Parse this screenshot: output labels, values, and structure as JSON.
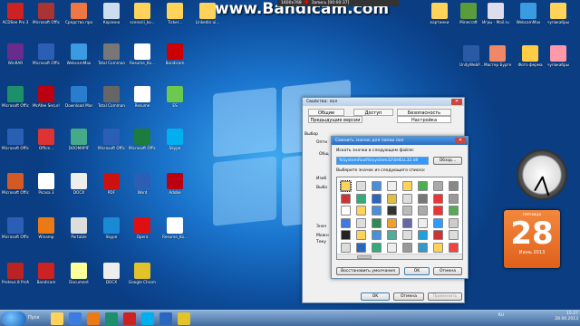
{
  "watermark": "www.Bandicam.com",
  "recorder": {
    "size": "1600x768",
    "status": "Запись [00:00:37]"
  },
  "desktop_left": [
    {
      "label": "ACDSee Pro 3",
      "color": "#c22"
    },
    {
      "label": "Microsoft Office Acc...",
      "color": "#a33"
    },
    {
      "label": "Средство просмот...",
      "color": "#e74"
    },
    {
      "label": "Корзина",
      "color": "#cde"
    },
    {
      "label": "scenarii_ko...",
      "color": "#ffd35a"
    },
    {
      "label": "Ticker...",
      "color": "#ffd35a"
    },
    {
      "label": "Linkedin ui...",
      "color": "#ffd35a"
    },
    {
      "label": "WinRAR",
      "color": "#6a2c8c"
    },
    {
      "label": "Microsoft Office Wo...",
      "color": "#2b5fb5"
    },
    {
      "label": "WebcamMax",
      "color": "#3b9be0"
    },
    {
      "label": "Total Commander",
      "color": "#777"
    },
    {
      "label": "Resume_Ko...",
      "color": "#fff"
    },
    {
      "label": "Bandicam",
      "color": "#c00"
    },
    {
      "label": "Microsoft Office Pu...",
      "color": "#1d8f6b"
    },
    {
      "label": "McAfee Security Sc...",
      "color": "#b01"
    },
    {
      "label": "Download Master",
      "color": "#2a7dcc"
    },
    {
      "label": "Total Commander",
      "color": "#666"
    },
    {
      "label": "Resume",
      "color": "#fff"
    },
    {
      "label": "ES",
      "color": "#6bc94f"
    },
    {
      "label": "Microsoft Office...",
      "color": "#2b5fb5"
    },
    {
      "label": "Office...",
      "color": "#d33"
    },
    {
      "label": "DOOMAPIF",
      "color": "#4a8"
    },
    {
      "label": "Microsoft Office...",
      "color": "#2b5fb5"
    },
    {
      "label": "Microsoft Office Exc...",
      "color": "#1e7b3e"
    },
    {
      "label": "Skype",
      "color": "#00aff0"
    },
    {
      "label": "Microsoft Office Power...",
      "color": "#d35a24"
    },
    {
      "label": "Picasa 3",
      "color": "#fff"
    },
    {
      "label": "DOCX",
      "color": "#eee"
    },
    {
      "label": "PDF",
      "color": "#c11"
    },
    {
      "label": "Word",
      "color": "#2b5fb5"
    },
    {
      "label": "Adobe",
      "color": "#b01"
    },
    {
      "label": "Microsoft Office...",
      "color": "#2b5fb5"
    },
    {
      "label": "Winamp",
      "color": "#ec7a14"
    },
    {
      "label": "Portable",
      "color": "#ddd"
    },
    {
      "label": "Skype",
      "color": "#1a8ad4"
    },
    {
      "label": "Opera",
      "color": "#d11"
    },
    {
      "label": "Resume_Ko...",
      "color": "#fff"
    },
    {
      "label": "Proteus 8 Professional",
      "color": "#b22"
    },
    {
      "label": "Bandicam",
      "color": "#c22"
    },
    {
      "label": "Document",
      "color": "#ff9"
    },
    {
      "label": "DOCX",
      "color": "#eee"
    },
    {
      "label": "Google Chrome",
      "color": "#e4c32a"
    }
  ],
  "desktop_right": [
    {
      "label": "картинки",
      "color": "#ffd35a"
    },
    {
      "label": "Minecraft",
      "color": "#5a9c3b"
    },
    {
      "label": "Игры - Mail.ru",
      "color": "#dde"
    },
    {
      "label": "WebcamMax",
      "color": "#3b9be0"
    },
    {
      "label": "чупакабры",
      "color": "#ffd35a"
    },
    {
      "label": "UnityWebP...",
      "color": "#2a5aa5"
    },
    {
      "label": "Мастер Бургер",
      "color": "#e86"
    },
    {
      "label": "Фото ферма",
      "color": "#fc4"
    },
    {
      "label": "чупакабры",
      "color": "#f9a"
    }
  ],
  "dialog_properties": {
    "title": "Свойства: лол",
    "tabs": [
      "Общие",
      "Доступ",
      "Безопасность",
      "Предыдущие версии",
      "Настройка"
    ],
    "partial_labels": [
      "Выбор",
      "Опти",
      "Общ",
      "Изоб",
      "Выбо",
      "Знач",
      "Можн",
      "Теку"
    ],
    "buttons": [
      "OK",
      "Отмена",
      "Применить"
    ]
  },
  "dialog_icon": {
    "title": "Сменить значок для папки лол",
    "search_label": "Искать значки в следующем файле:",
    "path_value": "%SystemRoot%\\system32\\SHELL32.dll",
    "browse_button": "Обзор...",
    "select_label": "Выберите значок из следующего списка:",
    "restore_button": "Восстановить умолчания",
    "ok_button": "OK",
    "cancel_button": "Отмена",
    "icon_colors": [
      "#ffd35a",
      "#ddd",
      "#4a8fd9",
      "#eee",
      "#ffd35a",
      "#4caf50",
      "#aaa",
      "#888",
      "#c33",
      "#3a7",
      "#2a66c0",
      "#e0c040",
      "#ddd",
      "#777",
      "#e33",
      "#999",
      "#fff",
      "#ffd35a",
      "#4a8fd9",
      "#333",
      "#bbb",
      "#aaa",
      "#e33",
      "#5a5",
      "#3b7be0",
      "#ddd",
      "#2e8b57",
      "#f0a030",
      "#66a",
      "#eee",
      "#39f",
      "#ccc",
      "#222",
      "#ffd35a",
      "#4a8fd9",
      "#5a9",
      "#ddd",
      "#1ea0dc",
      "#c33",
      "#ddd",
      "#ddd",
      "#2a66c0",
      "#3a7",
      "#eee",
      "#999",
      "#39c",
      "#ffd35a",
      "#e44"
    ]
  },
  "gadgets": {
    "weekday": "пятница",
    "day": "28",
    "month_year": "Июнь 2013"
  },
  "taskbar": {
    "start": "Пуск",
    "lang": "RU",
    "time": "15:27",
    "date": "28.06.2013",
    "pinned": [
      {
        "color": "#ffd35a"
      },
      {
        "color": "#3a7ce0"
      },
      {
        "color": "#ec7a14"
      },
      {
        "color": "#1d8f6b"
      },
      {
        "color": "#c22"
      },
      {
        "color": "#00aff0"
      },
      {
        "color": "#2a66c0"
      },
      {
        "color": "#e4c32a"
      }
    ]
  }
}
